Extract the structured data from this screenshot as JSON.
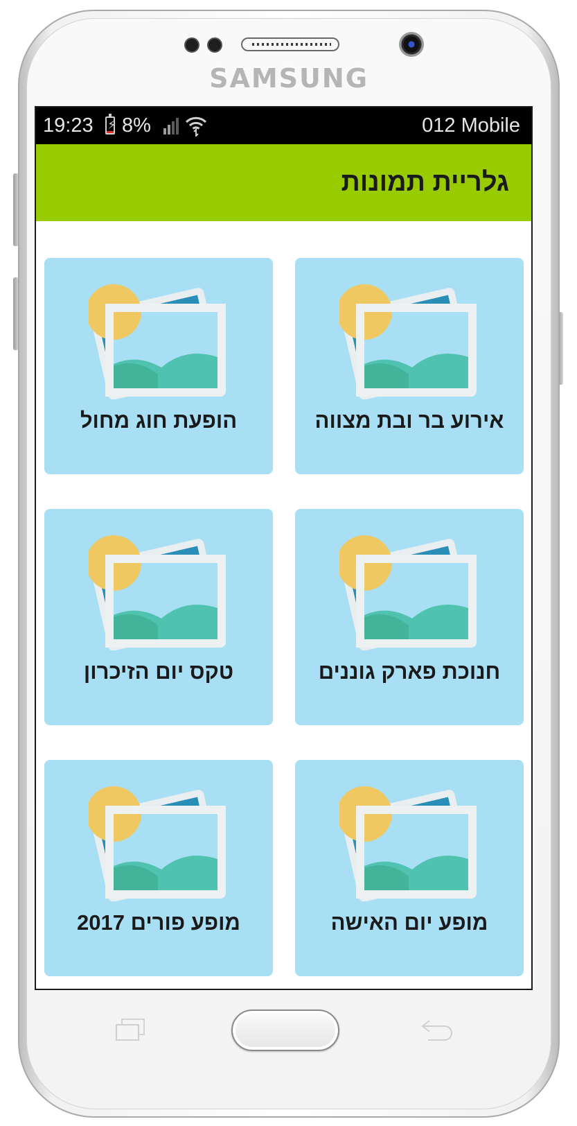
{
  "device": {
    "brand": "SAMSUNG"
  },
  "status_bar": {
    "time": "19:23",
    "battery": "8%",
    "carrier": "012 Mobile",
    "icons": [
      "battery-charging-icon",
      "signal-icon",
      "wifi-icon"
    ]
  },
  "app_bar": {
    "title": "גלריית תמונות",
    "color": "#99cc00"
  },
  "gallery": {
    "tile_color": "#a8dff4",
    "items": [
      {
        "label": "אירוע בר ובת מצווה",
        "icon": "photo-gallery-icon"
      },
      {
        "label": "הופעת חוג מחול",
        "icon": "photo-gallery-icon"
      },
      {
        "label": "חנוכת פארק גוננים",
        "icon": "photo-gallery-icon"
      },
      {
        "label": "טקס יום הזיכרון",
        "icon": "photo-gallery-icon"
      },
      {
        "label": "מופע יום האישה",
        "icon": "photo-gallery-icon"
      },
      {
        "label": "מופע פורים 2017",
        "icon": "photo-gallery-icon"
      }
    ]
  },
  "nav_keys": [
    "recent-apps-icon",
    "home-button",
    "back-icon"
  ]
}
